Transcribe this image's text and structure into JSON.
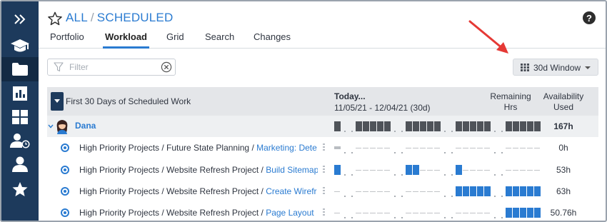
{
  "colors": {
    "sidebar": "#1d3a5c",
    "accent": "#2a7bd1",
    "bar_dark": "#4f5359",
    "bar_light": "#c0c3c7",
    "header_bg": "#e4e6e9"
  },
  "sidebar": {
    "items": [
      {
        "icon": "double-chevron-right-icon"
      },
      {
        "icon": "graduation-cap-icon"
      },
      {
        "icon": "folder-icon"
      },
      {
        "icon": "bar-chart-icon"
      },
      {
        "icon": "grid-icon"
      },
      {
        "icon": "user-clock-icon"
      },
      {
        "icon": "user-icon"
      },
      {
        "icon": "star-icon"
      }
    ]
  },
  "header": {
    "breadcrumb_root": "ALL",
    "breadcrumb_sep": "/",
    "breadcrumb_current": "SCHEDULED",
    "help": "?",
    "tabs": [
      {
        "label": "Portfolio"
      },
      {
        "label": "Workload",
        "active": true
      },
      {
        "label": "Grid"
      },
      {
        "label": "Search"
      },
      {
        "label": "Changes"
      }
    ]
  },
  "toolbar": {
    "filter_placeholder": "Filter",
    "window_label": "30d Window"
  },
  "table": {
    "header_title": "First 30 Days of Scheduled Work",
    "today_label": "Today...",
    "date_range": "11/05/21 - 12/04/21 (30d)",
    "remaining_header": "Remaining Hrs",
    "availability_header": "Availability Used",
    "person": {
      "name": "Dana",
      "availability": "167h"
    },
    "tasks": [
      {
        "path": "High Priority Projects / Future State Planning / ",
        "link": "Marketing: Dete…",
        "availability": "0h"
      },
      {
        "path": "High Priority Projects / Website Refresh Project / ",
        "link": "Build Sitemap",
        "availability": "53h"
      },
      {
        "path": "High Priority Projects / Website Refresh Project / ",
        "link": "Create Wirefr…",
        "availability": "63h"
      },
      {
        "path": "High Priority Projects / Website Refresh Project / ",
        "link": "Page Layout",
        "availability": "50.76h"
      }
    ]
  }
}
